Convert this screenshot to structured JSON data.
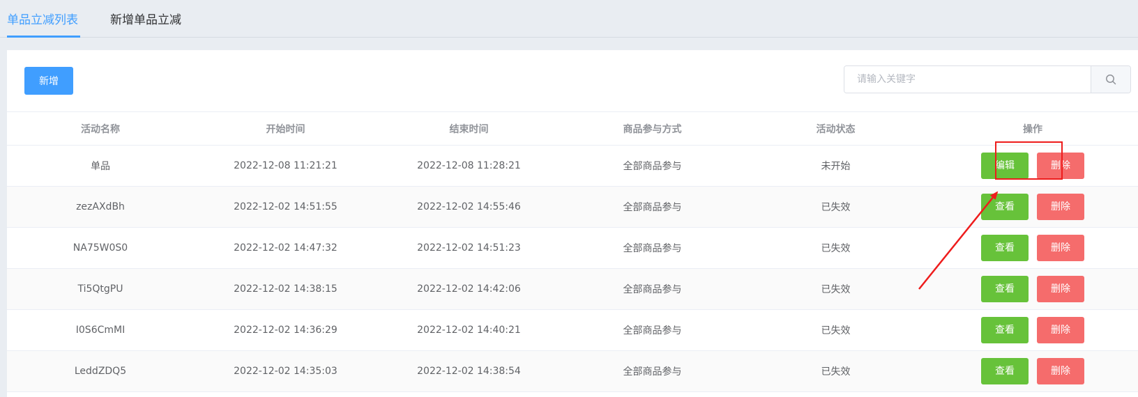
{
  "tabs": [
    {
      "label": "单品立减列表",
      "active": true
    },
    {
      "label": "新增单品立减",
      "active": false
    }
  ],
  "toolbar": {
    "add_label": "新增"
  },
  "search": {
    "placeholder": "请输入关键字",
    "value": ""
  },
  "table": {
    "headers": [
      "活动名称",
      "开始时间",
      "结束时间",
      "商品参与方式",
      "活动状态",
      "操作"
    ],
    "rows": [
      {
        "name": "单品",
        "start": "2022-12-08 11:21:21",
        "end": "2022-12-08 11:28:21",
        "mode": "全部商品参与",
        "status": "未开始",
        "primary_action": "编辑",
        "delete_action": "删除"
      },
      {
        "name": "zezAXdBh",
        "start": "2022-12-02 14:51:55",
        "end": "2022-12-02 14:55:46",
        "mode": "全部商品参与",
        "status": "已失效",
        "primary_action": "查看",
        "delete_action": "删除"
      },
      {
        "name": "NA75W0S0",
        "start": "2022-12-02 14:47:32",
        "end": "2022-12-02 14:51:23",
        "mode": "全部商品参与",
        "status": "已失效",
        "primary_action": "查看",
        "delete_action": "删除"
      },
      {
        "name": "Ti5QtgPU",
        "start": "2022-12-02 14:38:15",
        "end": "2022-12-02 14:42:06",
        "mode": "全部商品参与",
        "status": "已失效",
        "primary_action": "查看",
        "delete_action": "删除"
      },
      {
        "name": "I0S6CmMI",
        "start": "2022-12-02 14:36:29",
        "end": "2022-12-02 14:40:21",
        "mode": "全部商品参与",
        "status": "已失效",
        "primary_action": "查看",
        "delete_action": "删除"
      },
      {
        "name": "LeddZDQ5",
        "start": "2022-12-02 14:35:03",
        "end": "2022-12-02 14:38:54",
        "mode": "全部商品参与",
        "status": "已失效",
        "primary_action": "查看",
        "delete_action": "删除"
      }
    ]
  },
  "colors": {
    "accent": "#409eff",
    "success": "#67c23a",
    "danger": "#f56c6c",
    "annotation": "#ee1c1c"
  },
  "icons": {
    "search": "search-icon"
  }
}
